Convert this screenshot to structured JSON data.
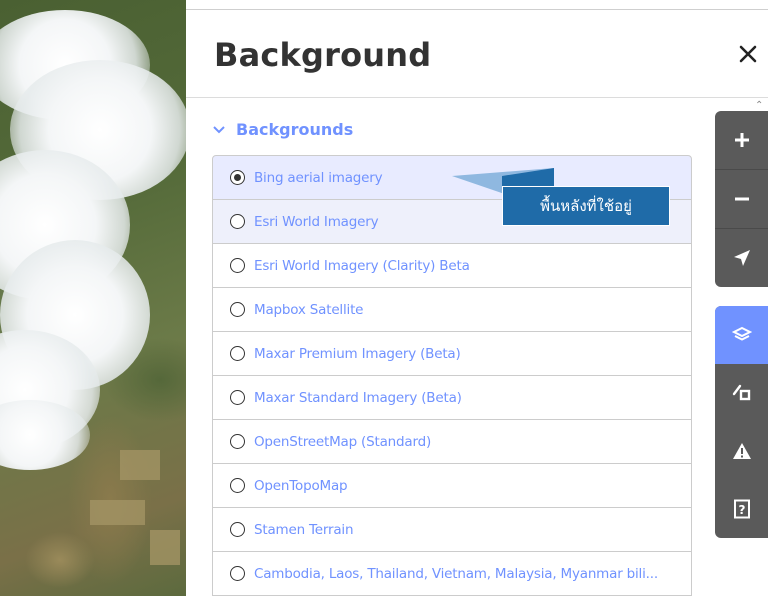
{
  "panel": {
    "title": "Background",
    "close_icon": "close-icon"
  },
  "section": {
    "title": "Backgrounds",
    "icon": "chevron-down-icon",
    "expanded": true
  },
  "backgrounds": [
    {
      "label": "Bing aerial imagery",
      "selected": true
    },
    {
      "label": "Esri World Imagery",
      "selected": false
    },
    {
      "label": "Esri World Imagery (Clarity) Beta",
      "selected": false
    },
    {
      "label": "Mapbox Satellite",
      "selected": false
    },
    {
      "label": "Maxar Premium Imagery (Beta)",
      "selected": false
    },
    {
      "label": "Maxar Standard Imagery (Beta)",
      "selected": false
    },
    {
      "label": "OpenStreetMap (Standard)",
      "selected": false
    },
    {
      "label": "OpenTopoMap",
      "selected": false
    },
    {
      "label": "Stamen Terrain",
      "selected": false
    },
    {
      "label": "Cambodia, Laos, Thailand, Vietnam, Malaysia, Myanmar bili...",
      "selected": false
    }
  ],
  "tooltip": {
    "text": "พื้นหลังที่ใช้อยู่"
  },
  "map_controls": {
    "zoom_group": [
      "zoom-in-icon",
      "zoom-out-icon",
      "geolocate-icon"
    ],
    "pane_group": [
      "layers-icon",
      "map-data-icon",
      "issues-icon",
      "help-icon"
    ],
    "active": "layers-icon"
  },
  "colors": {
    "accent": "#7092ff",
    "selected_row": "#e8ebff",
    "tooltip_bg": "#1f6ba8",
    "control_bg": "#5a5a5a",
    "title_text": "#333333"
  }
}
